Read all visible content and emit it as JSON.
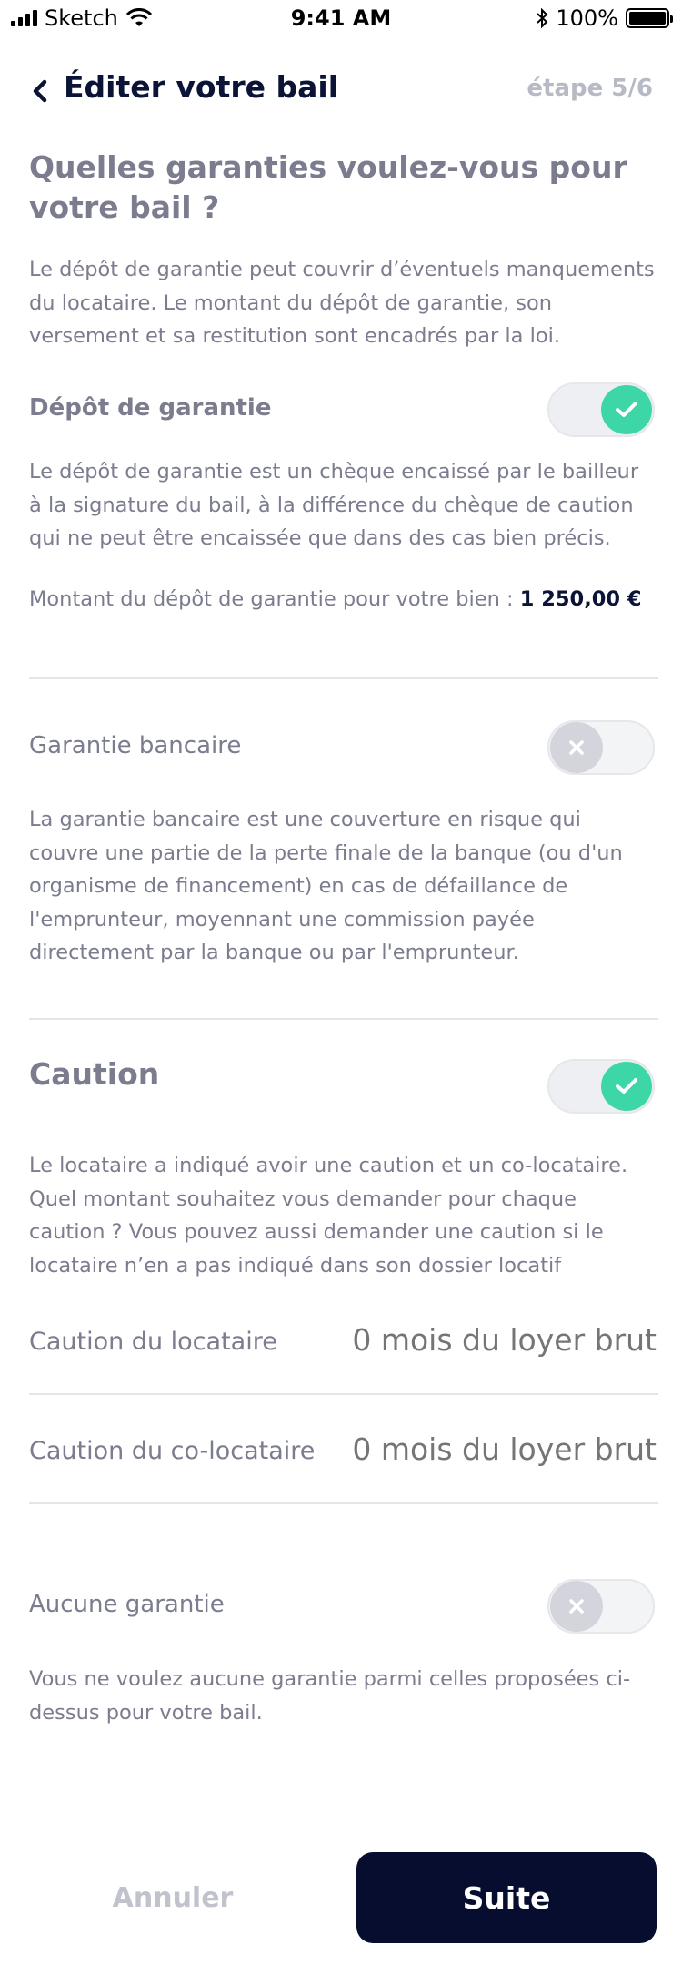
{
  "status_bar": {
    "carrier": "Sketch",
    "time": "9:41 AM",
    "battery": "100%"
  },
  "header": {
    "title": "Éditer votre bail",
    "step": "étape 5/6"
  },
  "intro": {
    "heading": "Quelles garanties voulez-vous pour votre bail ?",
    "text": "Le dépôt de garantie peut couvrir d’éventuels manquements du locataire. Le montant du dépôt de garantie, son versement et sa restitution sont encadrés par la loi."
  },
  "depot": {
    "title": "Dépôt de garantie",
    "toggle_on": true,
    "description": "Le dépôt de garantie est un chèque encaissé par le bailleur à la signature du bail, à la différence du chèque de caution qui ne peut être encaissée que dans des cas bien précis.",
    "amount_label": "Montant du dépôt de garantie pour votre bien  :",
    "amount_value": "1 250,00 €"
  },
  "garantie_bancaire": {
    "title": "Garantie bancaire",
    "toggle_on": false,
    "description": "La garantie bancaire est une couverture en risque qui couvre une partie de la perte finale de la banque (ou d'un organisme de financement) en cas de défaillance de l'emprunteur, moyennant une commission payée directement par la banque ou par l'emprunteur."
  },
  "caution": {
    "title": "Caution",
    "toggle_on": true,
    "description": "Le locataire a indiqué avoir une caution et un co-locataire. Quel montant souhaitez vous demander pour chaque caution ? Vous pouvez aussi demander une caution si le locataire n’en a pas indiqué dans son dossier locatif",
    "rows": [
      {
        "label": "Caution du locataire",
        "placeholder": "0 mois du loyer brut"
      },
      {
        "label": "Caution du co-locataire",
        "placeholder": "0 mois du loyer brut"
      }
    ]
  },
  "aucune": {
    "title": "Aucune garantie",
    "toggle_on": false,
    "description": "Vous ne voulez aucune garantie parmi celles proposées ci-dessus pour votre bail."
  },
  "actions": {
    "cancel_label": "Annuler",
    "next_label": "Suite"
  },
  "colors": {
    "accent_green": "#3dd6a7",
    "navy": "#0b1437",
    "button_dark": "#060d2e"
  }
}
